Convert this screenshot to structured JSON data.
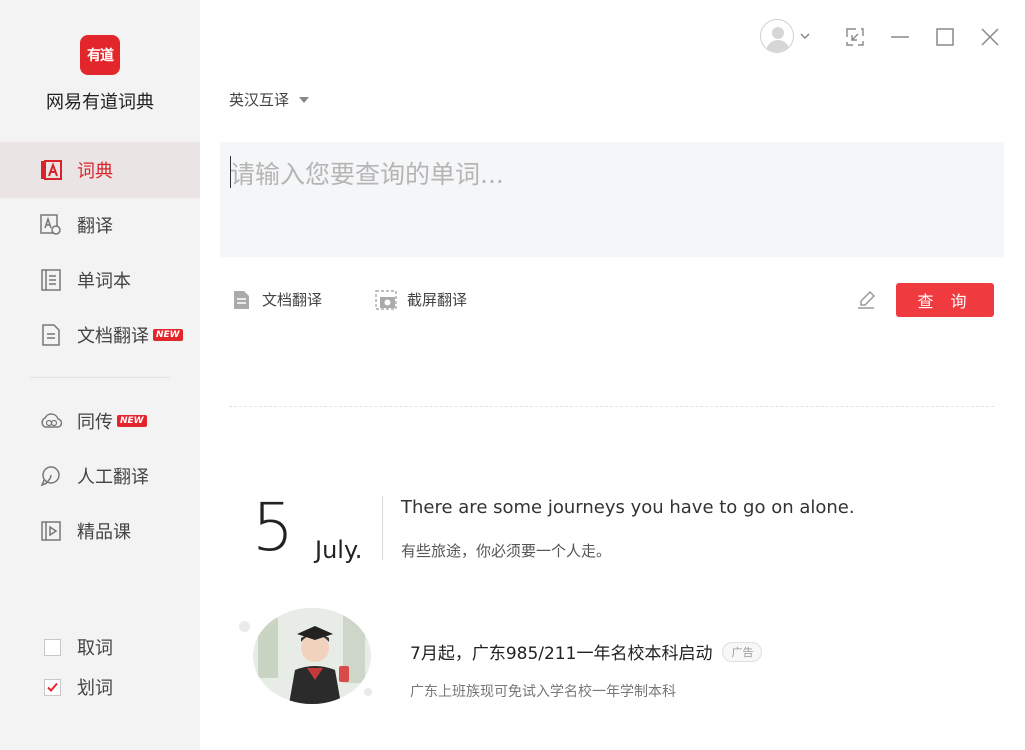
{
  "app": {
    "logo_text": "有道",
    "name": "网易有道词典"
  },
  "sidebar": {
    "items": [
      {
        "label": "词典",
        "icon": "dictionary-icon",
        "active": true
      },
      {
        "label": "翻译",
        "icon": "translate-icon"
      },
      {
        "label": "单词本",
        "icon": "wordbook-icon"
      },
      {
        "label": "文档翻译",
        "icon": "document-icon",
        "badge": "NEW"
      },
      {
        "label": "同传",
        "icon": "cloud-icon",
        "badge": "NEW"
      },
      {
        "label": "人工翻译",
        "icon": "headset-icon"
      },
      {
        "label": "精品课",
        "icon": "video-course-icon"
      }
    ],
    "checks": [
      {
        "label": "取词",
        "checked": false
      },
      {
        "label": "划词",
        "checked": true
      }
    ]
  },
  "header": {
    "lang_selector": "英汉互译"
  },
  "search": {
    "placeholder": "请输入您要查询的单词..."
  },
  "tools": {
    "doc_translate": "文档翻译",
    "screen_translate": "截屏翻译",
    "query_button": "查 询"
  },
  "daily": {
    "day": "5",
    "month": "July.",
    "sentence_en": "There are some journeys you have to go on alone.",
    "sentence_cn": "有些旅途，你必须要一个人走。"
  },
  "ad": {
    "title": "7月起，广东985/211一年名校本科启动",
    "tag": "广告",
    "subtitle": "广东上班族现可免试入学名校一年学制本科"
  },
  "colors": {
    "accent": "#e3262c",
    "button": "#ef3b3f",
    "sidebar_bg": "#f3f3f3",
    "active_bg": "#ebe4e4"
  }
}
